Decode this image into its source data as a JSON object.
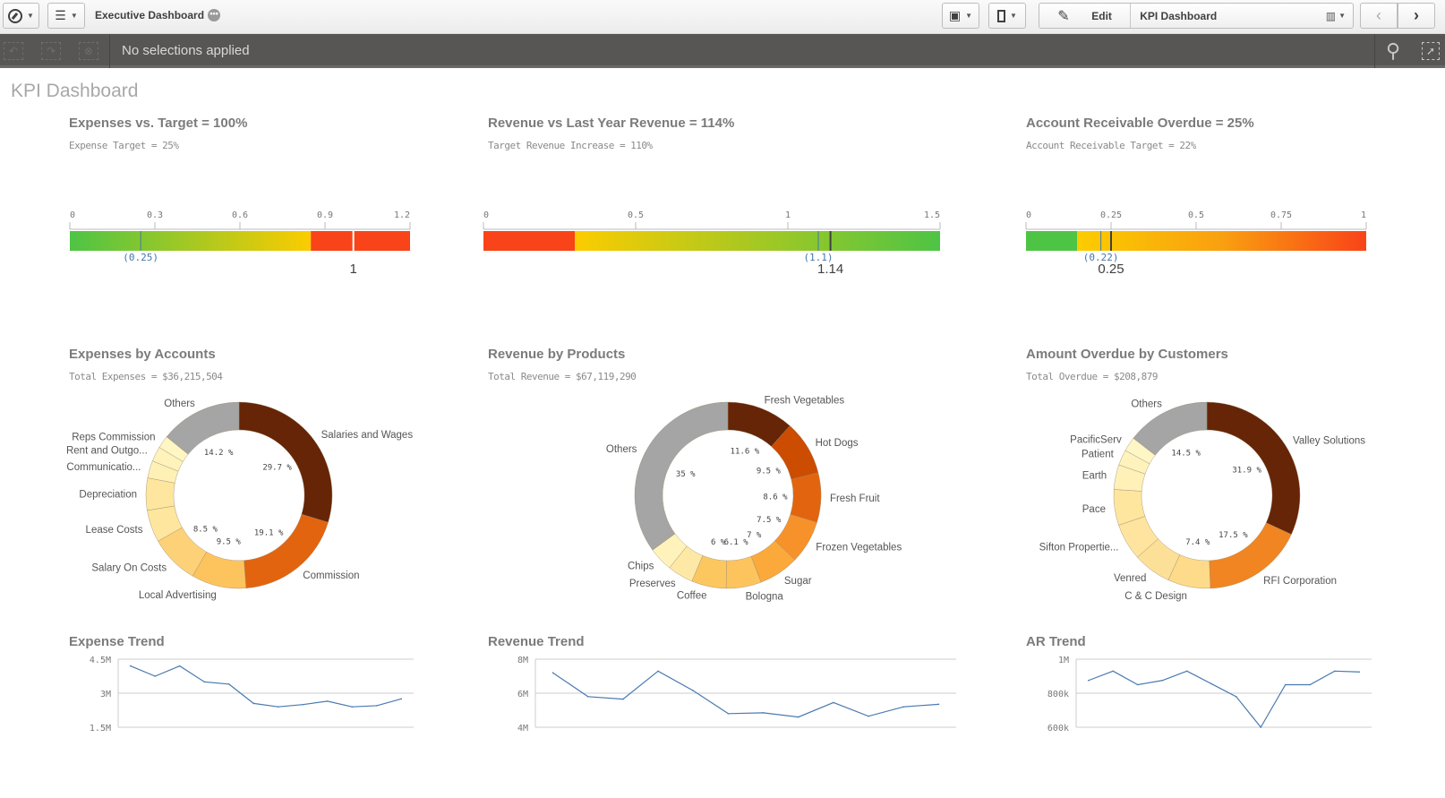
{
  "toolbar": {
    "app_title": "Executive Dashboard",
    "edit_label": "Edit",
    "sheet_name": "KPI Dashboard",
    "icons": [
      "compass-icon",
      "list-icon",
      "presentation-icon",
      "bookmark-icon",
      "pencil-icon",
      "chart-icon",
      "chevron-left-icon",
      "chevron-right-icon"
    ]
  },
  "selections": {
    "text": "No selections applied",
    "icons": [
      "step-back-icon",
      "step-forward-icon",
      "clear-selections-icon",
      "search-icon",
      "selection-tool-icon"
    ]
  },
  "sheet_title": "KPI Dashboard",
  "colors": {
    "red": "#f94318",
    "yellow": "#fccc00",
    "green": "#4ec445",
    "target_marker": "#4477aa",
    "value_marker": "#404040",
    "line": "#4a7ab0",
    "others": "#a5a5a5"
  },
  "chart_data": [
    {
      "type": "gauge",
      "id": "expenses_vs_target",
      "title": "Expenses vs. Target = 100%",
      "subtitle": "Expense Target = 25%",
      "range": [
        0,
        1.2
      ],
      "ticks": [
        "0",
        "0.3",
        "0.6",
        "0.9",
        "1.2"
      ],
      "tick_values": [
        0,
        0.3,
        0.6,
        0.9,
        1.2
      ],
      "segments": [
        {
          "from": 0,
          "to": 0.85,
          "gradient": [
            "#4ec445",
            "#fccc00"
          ]
        },
        {
          "from": 0.85,
          "to": 1.2,
          "color": "#f94318"
        }
      ],
      "target": 0.25,
      "target_label": "(0.25)",
      "value": 1,
      "value_label": "1"
    },
    {
      "type": "gauge",
      "id": "revenue_vs_last_year",
      "title": "Revenue vs Last Year Revenue = 114%",
      "subtitle": "Target Revenue Increase = 110%",
      "range": [
        0,
        1.5
      ],
      "ticks": [
        "0",
        "0.5",
        "1",
        "1.5"
      ],
      "tick_values": [
        0,
        0.5,
        1,
        1.5
      ],
      "segments": [
        {
          "from": 0,
          "to": 0.3,
          "color": "#f94318"
        },
        {
          "from": 0.3,
          "to": 1.5,
          "gradient": [
            "#fccc00",
            "#4ec445"
          ]
        }
      ],
      "target": 1.1,
      "target_label": "(1.1)",
      "value": 1.14,
      "value_label": "1.14"
    },
    {
      "type": "gauge",
      "id": "ar_overdue",
      "title": "Account Receivable Overdue = 25%",
      "subtitle": "Account Receivable Target = 22%",
      "range": [
        0,
        1
      ],
      "ticks": [
        "0",
        "0.25",
        "0.5",
        "0.75",
        "1"
      ],
      "tick_values": [
        0,
        0.25,
        0.5,
        0.75,
        1
      ],
      "segments": [
        {
          "from": 0,
          "to": 0.15,
          "color": "#4ec445"
        },
        {
          "from": 0.15,
          "to": 1,
          "gradient": [
            "#fccc00",
            "#f9a010",
            "#f94318"
          ]
        }
      ],
      "target": 0.22,
      "target_label": "(0.22)",
      "value": 0.25,
      "value_label": "0.25"
    },
    {
      "type": "pie",
      "id": "expenses_by_accounts",
      "title": "Expenses by Accounts",
      "subtitle": "Total Expenses = $36,215,504",
      "slices": [
        {
          "label": "Salaries and Wages",
          "value": 29.7,
          "pct_label": "29.7 %",
          "color": "#662506"
        },
        {
          "label": "Commission",
          "value": 19.1,
          "pct_label": "19.1 %",
          "color": "#e3640e"
        },
        {
          "label": "Local Advertising",
          "value": 9.5,
          "pct_label": "9.5 %",
          "color": "#fdc45e"
        },
        {
          "label": "Salary On Costs",
          "value": 8.5,
          "pct_label": "8.5 %",
          "color": "#fdd177"
        },
        {
          "label": "Lease Costs",
          "value": 5.6,
          "pct_label": "",
          "color": "#fee69e"
        },
        {
          "label": "Depreciation",
          "value": 5.6,
          "pct_label": "",
          "color": "#fee69e"
        },
        {
          "label": "Communicatio...",
          "value": 3.0,
          "pct_label": "",
          "color": "#fff1b5"
        },
        {
          "label": "Rent and Outgo...",
          "value": 2.6,
          "pct_label": "",
          "color": "#fff3bb"
        },
        {
          "label": "Reps Commission",
          "value": 2.2,
          "pct_label": "",
          "color": "#fff6c4"
        },
        {
          "label": "Others",
          "value": 14.2,
          "pct_label": "14.2 %",
          "color": "#a5a5a5"
        }
      ]
    },
    {
      "type": "pie",
      "id": "revenue_by_products",
      "title": "Revenue by Products",
      "subtitle": "Total Revenue = $67,119,290",
      "slices": [
        {
          "label": "Fresh Vegetables",
          "value": 11.6,
          "pct_label": "11.6 %",
          "color": "#662506"
        },
        {
          "label": "Hot Dogs",
          "value": 9.5,
          "pct_label": "9.5 %",
          "color": "#cc4c02"
        },
        {
          "label": "Fresh Fruit",
          "value": 8.6,
          "pct_label": "8.6 %",
          "color": "#e3640e"
        },
        {
          "label": "Frozen Vegetables",
          "value": 7.5,
          "pct_label": "7.5 %",
          "color": "#f7922a"
        },
        {
          "label": "Sugar",
          "value": 7.0,
          "pct_label": "7 %",
          "color": "#fba93a"
        },
        {
          "label": "Bologna",
          "value": 6.1,
          "pct_label": "6.1 %",
          "color": "#fdc45e"
        },
        {
          "label": "Coffee",
          "value": 6.0,
          "pct_label": "6 %",
          "color": "#fdc760"
        },
        {
          "label": "Preserves",
          "value": 4.5,
          "pct_label": "",
          "color": "#fee8a5"
        },
        {
          "label": "Chips",
          "value": 4.2,
          "pct_label": "",
          "color": "#fff3bb"
        },
        {
          "label": "Others",
          "value": 35,
          "pct_label": "35 %",
          "color": "#a5a5a5"
        }
      ]
    },
    {
      "type": "pie",
      "id": "amount_overdue_by_customers",
      "title": "Amount Overdue by Customers",
      "subtitle": "Total Overdue = $208,879",
      "slices": [
        {
          "label": "Valley  Solutions",
          "value": 31.9,
          "pct_label": "31.9 %",
          "color": "#662506"
        },
        {
          "label": "RFI Corporation",
          "value": 17.5,
          "pct_label": "17.5 %",
          "color": "#f18521"
        },
        {
          "label": "C & C  Design",
          "value": 7.4,
          "pct_label": "7.4 %",
          "color": "#fddb8a"
        },
        {
          "label": "Venred",
          "value": 6.6,
          "pct_label": "",
          "color": "#fde097"
        },
        {
          "label": "Sifton Propertie...",
          "value": 6.4,
          "pct_label": "",
          "color": "#fee49e"
        },
        {
          "label": "Pace",
          "value": 6.2,
          "pct_label": "",
          "color": "#fee69f"
        },
        {
          "label": "Earth",
          "value": 4.3,
          "pct_label": "",
          "color": "#fff1b8"
        },
        {
          "label": "Patient",
          "value": 2.7,
          "pct_label": "",
          "color": "#fff3bd"
        },
        {
          "label": "PacificServ",
          "value": 2.5,
          "pct_label": "",
          "color": "#fff6c6"
        },
        {
          "label": "Others",
          "value": 14.5,
          "pct_label": "14.5 %",
          "color": "#a5a5a5"
        }
      ]
    },
    {
      "type": "line",
      "id": "expense_trend",
      "title": "Expense Trend",
      "ylim": [
        1500000,
        4500000
      ],
      "yticks": [
        "4.5M",
        "3M",
        "1.5M"
      ],
      "ytick_values": [
        4500000,
        3000000,
        1500000
      ],
      "values": [
        4200000,
        3750000,
        4200000,
        3500000,
        3400000,
        2550000,
        2400000,
        2500000,
        2650000,
        2400000,
        2450000,
        2750000
      ],
      "grid": true
    },
    {
      "type": "line",
      "id": "revenue_trend",
      "title": "Revenue Trend",
      "ylim": [
        4000000,
        8000000
      ],
      "yticks": [
        "8M",
        "6M",
        "4M"
      ],
      "ytick_values": [
        8000000,
        6000000,
        4000000
      ],
      "values": [
        7200000,
        5800000,
        5650000,
        7300000,
        6150000,
        4800000,
        4850000,
        4600000,
        5450000,
        4650000,
        5200000,
        5350000
      ],
      "grid": true
    },
    {
      "type": "line",
      "id": "ar_trend",
      "title": "AR Trend",
      "ylim": [
        600000,
        1000000
      ],
      "yticks": [
        "1M",
        "800k",
        "600k"
      ],
      "ytick_values": [
        1000000,
        800000,
        600000
      ],
      "values": [
        875000,
        930000,
        850000,
        875000,
        930000,
        855000,
        780000,
        600000,
        850000,
        850000,
        930000,
        925000
      ],
      "grid": true
    }
  ]
}
